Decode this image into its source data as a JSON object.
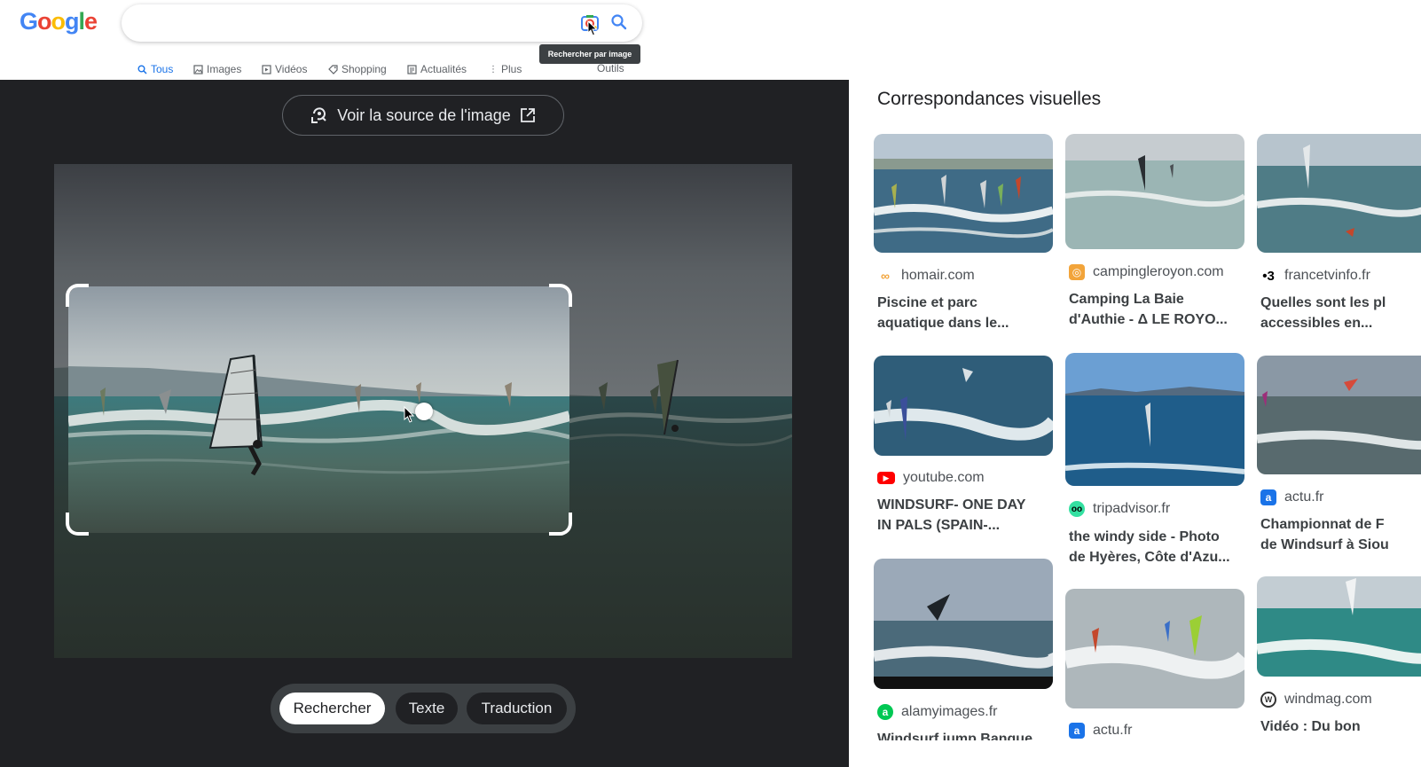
{
  "header": {
    "logo": "Google",
    "search_value": "",
    "tooltip": "Rechercher par image"
  },
  "tabs": [
    {
      "label": "Tous",
      "icon": "search-icon",
      "active": true
    },
    {
      "label": "Images",
      "icon": "image-icon",
      "active": false
    },
    {
      "label": "Vidéos",
      "icon": "video-icon",
      "active": false
    },
    {
      "label": "Shopping",
      "icon": "tag-icon",
      "active": false
    },
    {
      "label": "Actualités",
      "icon": "news-icon",
      "active": false
    },
    {
      "label": "Plus",
      "icon": "more-vert-icon",
      "active": false
    }
  ],
  "tools_label": "Outils",
  "lens": {
    "source_button": "Voir la source de l'image",
    "modes": [
      {
        "label": "Rechercher",
        "active": true
      },
      {
        "label": "Texte",
        "active": false
      },
      {
        "label": "Traduction",
        "active": false
      }
    ]
  },
  "results": {
    "title": "Correspondances visuelles",
    "items": [
      {
        "source": "homair.com",
        "caption1": "Piscine et parc",
        "caption2": "aquatique dans le..."
      },
      {
        "source": "campingleroyon.com",
        "caption1": "Camping La Baie",
        "caption2": "d'Authie - Δ LE ROYO..."
      },
      {
        "source": "francetvinfo.fr",
        "caption1": "Quelles sont les pl",
        "caption2": "accessibles en..."
      },
      {
        "source": "youtube.com",
        "caption1": "WINDSURF- ONE DAY",
        "caption2": "IN PALS (SPAIN-..."
      },
      {
        "source": "tripadvisor.fr",
        "caption1": "the windy side - Photo",
        "caption2": "de Hyères, Côte d'Azu..."
      },
      {
        "source": "actu.fr",
        "caption1": "Championnat de F",
        "caption2": "de Windsurf à Siou"
      },
      {
        "source": "alamyimages.fr",
        "caption1": "Windsurf jump Banque",
        "caption2": ""
      },
      {
        "source": "actu.fr",
        "caption1": "",
        "caption2": ""
      },
      {
        "source": "windmag.com",
        "caption1": "Vidéo : Du bon",
        "caption2": ""
      }
    ]
  },
  "colors": {
    "accent": "#1a73e8",
    "dark_panel": "#202124",
    "google_blue": "#4285f4",
    "google_red": "#ea4335",
    "google_yellow": "#fbbc05",
    "google_green": "#34a853"
  }
}
